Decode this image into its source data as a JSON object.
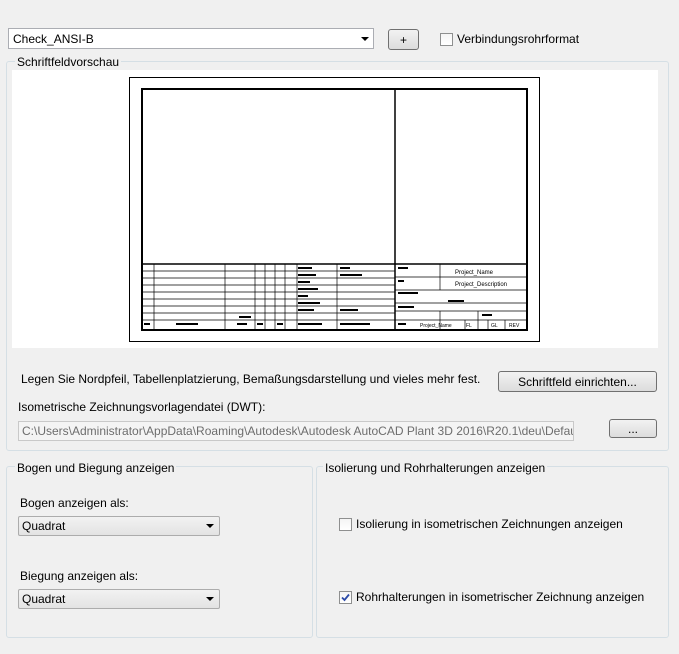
{
  "top": {
    "template_value": "Check_ANSI-B",
    "add_label": "+",
    "connector_checkbox_label": "Verbindungsrohrformat"
  },
  "preview": {
    "group_title": "Schriftfeldvorschau",
    "title_block": {
      "project_name": "Project_Name",
      "project_description": "Project_Description",
      "small_texts": [
        "Client",
        "Datum",
        "Drawn by",
        "Checked",
        "FL",
        "GL",
        "REV"
      ]
    }
  },
  "info": {
    "description": "Legen Sie Nordpfeil, Tabellenplatzierung, Bemaßungsdarstellung und vieles mehr fest.",
    "setup_button": "Schriftfeld einrichten...",
    "dwt_label": "Isometrische Zeichnungsvorlagendatei (DWT):",
    "dwt_path": "C:\\Users\\Administrator\\AppData\\Roaming\\Autodesk\\Autodesk AutoCAD Plant 3D 2016\\R20.1\\deu\\DefaultProject\\",
    "browse_button": "..."
  },
  "bends": {
    "group_title": "Bogen und Biegung anzeigen",
    "arc_label": "Bogen anzeigen als:",
    "arc_value": "Quadrat",
    "bend_label": "Biegung anzeigen als:",
    "bend_value": "Quadrat"
  },
  "insulation": {
    "group_title": "Isolierung und Rohrhalterungen anzeigen",
    "insulation_label": "Isolierung in isometrischen Zeichnungen anzeigen",
    "insulation_checked": false,
    "supports_label": "Rohrhalterungen in isometrischer Zeichnung anzeigen",
    "supports_checked": true
  },
  "colors": {
    "window_bg": "#f0f0f0",
    "group_border": "#d5dfe5",
    "check_blue": "#2b4aa8"
  }
}
